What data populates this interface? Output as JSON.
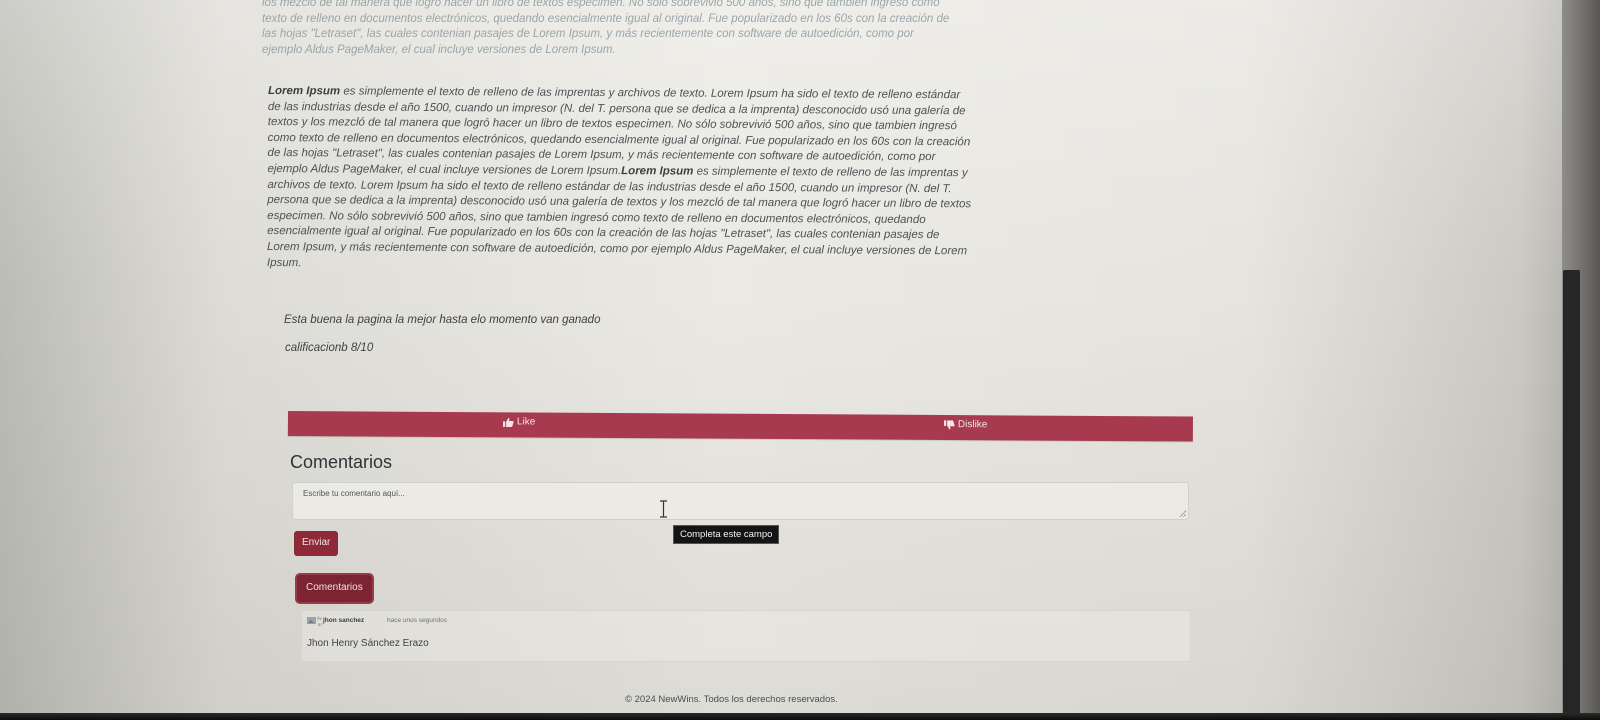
{
  "article": {
    "para1_html": "los mezcló de tal manera que logró hacer un libro de textos especimen. No sólo sobrevivió 500 años, sino que tambien ingresó como texto de relleno en documentos electrónicos, quedando esencialmente igual al original. Fue popularizado en los 60s con la creación de las hojas \"Letraset\", las cuales contenian pasajes de Lorem Ipsum, y más recientemente con software de autoedición, como por ejemplo Aldus PageMaker, el cual incluye versiones de Lorem Ipsum.",
    "para2_html": "<b>Lorem Ipsum</b> es simplemente el texto de relleno de las imprentas y archivos de texto. Lorem Ipsum ha sido el texto de relleno estándar de las industrias desde el año 1500, cuando un impresor (N. del T. persona que se dedica a la imprenta) desconocido usó una galería de textos y los mezcló de tal manera que logró hacer un libro de textos especimen. No sólo sobrevivió 500 años, sino que tambien ingresó como texto de relleno en documentos electrónicos, quedando esencialmente igual al original. Fue popularizado en los 60s con la creación de las hojas \"Letraset\", las cuales contenian pasajes de Lorem Ipsum, y más recientemente con software de autoedición, como por ejemplo Aldus PageMaker, el cual incluye versiones de Lorem Ipsum.<b>Lorem Ipsum</b> es simplemente el texto de relleno de las imprentas y archivos de texto. Lorem Ipsum ha sido el texto de relleno estándar de las industrias desde el año 1500, cuando un impresor (N. del T. persona que se dedica a la imprenta) desconocido usó una galería de textos y los mezcló de tal manera que logró hacer un libro de textos especimen. No sólo sobrevivió 500 años, sino que tambien ingresó como texto de relleno en documentos electrónicos, quedando esencialmente igual al original. Fue popularizado en los 60s con la creación de las hojas \"Letraset\", las cuales contenian pasajes de Lorem Ipsum, y más recientemente con software de autoedición, como por ejemplo Aldus PageMaker, el cual incluye versiones de Lorem Ipsum."
  },
  "review": {
    "text": "Esta buena la pagina la mejor hasta elo momento van ganado",
    "rating": "calificacionb 8/10"
  },
  "votes": {
    "like_label": "Like",
    "dislike_label": "Dislike",
    "bar_color": "#a73a4e"
  },
  "comments_section": {
    "title": "Comentarios",
    "input_placeholder": "Escribe tu comentario aquí...",
    "validation_tooltip": "Completa este campo",
    "send_label": "Enviar",
    "toggle_label": "Comentarios",
    "list": [
      {
        "author": "jhon sanchez",
        "time": "hace unos segundos",
        "body": "Jhon Henry Sánchez Erazo",
        "avatar_icon": "broken-image-icon"
      }
    ]
  },
  "footer": {
    "copyright": "© 2024 NewWins. Todos los derechos reservados."
  },
  "colors": {
    "accent": "#8e2a38",
    "accent_dark": "#7b2433"
  }
}
